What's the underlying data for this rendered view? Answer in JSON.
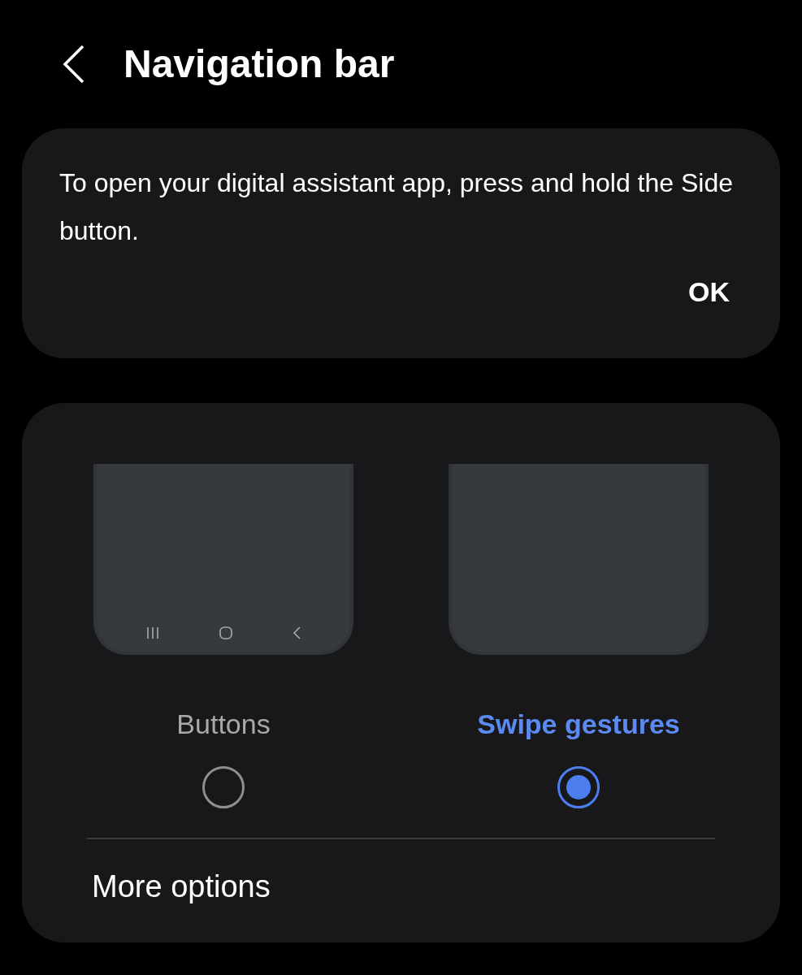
{
  "header": {
    "title": "Navigation bar"
  },
  "notice": {
    "message": "To open your digital assistant app, press and hold the Side button.",
    "action": "OK"
  },
  "options": [
    {
      "kind": "buttons",
      "label": "Buttons",
      "selected": false
    },
    {
      "kind": "gestures",
      "label": "Swipe gestures",
      "selected": true
    }
  ],
  "more_options": "More options"
}
